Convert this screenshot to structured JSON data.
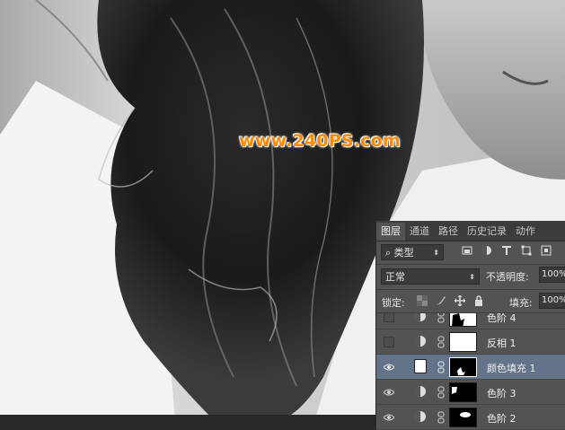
{
  "watermark": "www.240PS.com",
  "panel": {
    "tabs": [
      "图层",
      "通道",
      "路径",
      "历史记录",
      "动作"
    ],
    "filter_kind": "类型",
    "blend_mode": "正常",
    "opacity_label": "不透明度:",
    "opacity_value": "100%",
    "lock_label": "锁定:",
    "fill_label": "填充:",
    "fill_value": "100%",
    "layers": [
      {
        "name": "色阶 4",
        "visible": false,
        "kind": "adjustment",
        "selected": false
      },
      {
        "name": "反相 1",
        "visible": false,
        "kind": "adjustment",
        "selected": false
      },
      {
        "name": "颜色填充 1",
        "visible": true,
        "kind": "fill",
        "selected": true
      },
      {
        "name": "色阶 3",
        "visible": true,
        "kind": "adjustment",
        "selected": false
      },
      {
        "name": "色阶 2",
        "visible": true,
        "kind": "adjustment",
        "selected": false
      }
    ]
  },
  "colors": {
    "panel_bg": "#535353",
    "selected_layer": "#63748a",
    "watermark": "#ff8a00"
  }
}
